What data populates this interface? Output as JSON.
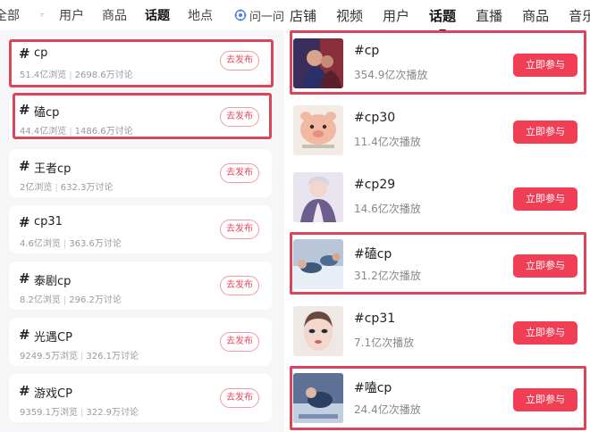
{
  "left_tabs": {
    "all": "全部",
    "users": "用户",
    "products": "商品",
    "topics": "话题",
    "places": "地点",
    "ask": "问一问"
  },
  "left_topics": [
    {
      "title": "cp",
      "views": "51.4亿浏览",
      "discussions": "2698.6万讨论",
      "button": "去发布"
    },
    {
      "title": "磕cp",
      "views": "44.4亿浏览",
      "discussions": "1486.6万讨论",
      "button": "去发布"
    },
    {
      "title": "王者cp",
      "views": "2亿浏览",
      "discussions": "632.3万讨论",
      "button": "去发布"
    },
    {
      "title": "cp31",
      "views": "4.6亿浏览",
      "discussions": "363.6万讨论",
      "button": "去发布"
    },
    {
      "title": "泰剧cp",
      "views": "8.2亿浏览",
      "discussions": "296.2万讨论",
      "button": "去发布"
    },
    {
      "title": "光遇CP",
      "views": "9249.5万浏览",
      "discussions": "326.1万讨论",
      "button": "去发布"
    },
    {
      "title": "游戏CP",
      "views": "9359.1万浏览",
      "discussions": "322.9万讨论",
      "button": "去发布"
    }
  ],
  "right_tabs": {
    "stores": "店铺",
    "videos": "视频",
    "users": "用户",
    "topics": "话题",
    "live": "直播",
    "products": "商品",
    "music": "音乐"
  },
  "right_topics": [
    {
      "title": "#cp",
      "plays": "354.9亿次播放",
      "button": "立即参与"
    },
    {
      "title": "#cp30",
      "plays": "11.4亿次播放",
      "button": "立即参与"
    },
    {
      "title": "#cp29",
      "plays": "14.6亿次播放",
      "button": "立即参与"
    },
    {
      "title": "#磕cp",
      "plays": "31.2亿次播放",
      "button": "立即参与"
    },
    {
      "title": "#cp31",
      "plays": "7.1亿次播放",
      "button": "立即参与"
    },
    {
      "title": "#嗑cp",
      "plays": "24.4亿次播放",
      "button": "立即参与"
    }
  ],
  "colors": {
    "accent": "#f03e55",
    "highlight": "#d9455a",
    "outline_button": "#e8485c"
  }
}
